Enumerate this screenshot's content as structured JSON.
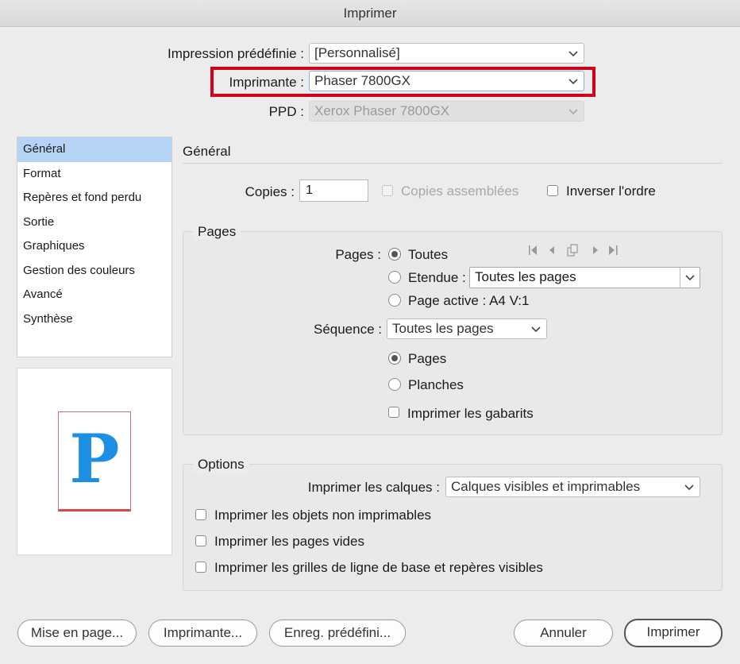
{
  "window": {
    "title": "Imprimer"
  },
  "header": {
    "preset_label": "Impression prédéfinie :",
    "preset_value": "[Personnalisé]",
    "printer_label": "Imprimante :",
    "printer_value": "Phaser 7800GX",
    "ppd_label": "PPD :",
    "ppd_value": "Xerox Phaser 7800GX"
  },
  "sidebar": {
    "items": [
      {
        "label": "Général"
      },
      {
        "label": "Format"
      },
      {
        "label": "Repères et fond perdu"
      },
      {
        "label": "Sortie"
      },
      {
        "label": "Graphiques"
      },
      {
        "label": "Gestion des couleurs"
      },
      {
        "label": "Avancé"
      },
      {
        "label": "Synthèse"
      }
    ],
    "selected": "Général"
  },
  "preview": {
    "letter": "P"
  },
  "general": {
    "title": "Général",
    "copies_label": "Copies :",
    "copies_value": "1",
    "collate_label": "Copies assemblées",
    "reverse_label": "Inverser l'ordre"
  },
  "pages": {
    "group_title": "Pages",
    "pages_label": "Pages :",
    "all_label": "Toutes",
    "range_label": "Etendue :",
    "range_value": "Toutes les pages",
    "current_label": "Page active : A4 V:1",
    "sequence_label": "Séquence :",
    "sequence_value": "Toutes les pages",
    "pages_option": "Pages",
    "spreads_option": "Planches",
    "masters_label": "Imprimer les gabarits"
  },
  "options": {
    "group_title": "Options",
    "layers_label": "Imprimer les calques :",
    "layers_value": "Calques visibles et imprimables",
    "nonprinting_label": "Imprimer les objets non imprimables",
    "blank_pages_label": "Imprimer les pages vides",
    "grids_label": "Imprimer les grilles de ligne de base et repères visibles"
  },
  "buttons": {
    "page_setup": "Mise en page...",
    "printer": "Imprimante...",
    "save_preset": "Enreg. prédéfini...",
    "cancel": "Annuler",
    "print": "Imprimer"
  },
  "colors": {
    "highlight": "#d0021b",
    "selection": "#b5d4f5",
    "preview_letter": "#1a8fe3"
  }
}
